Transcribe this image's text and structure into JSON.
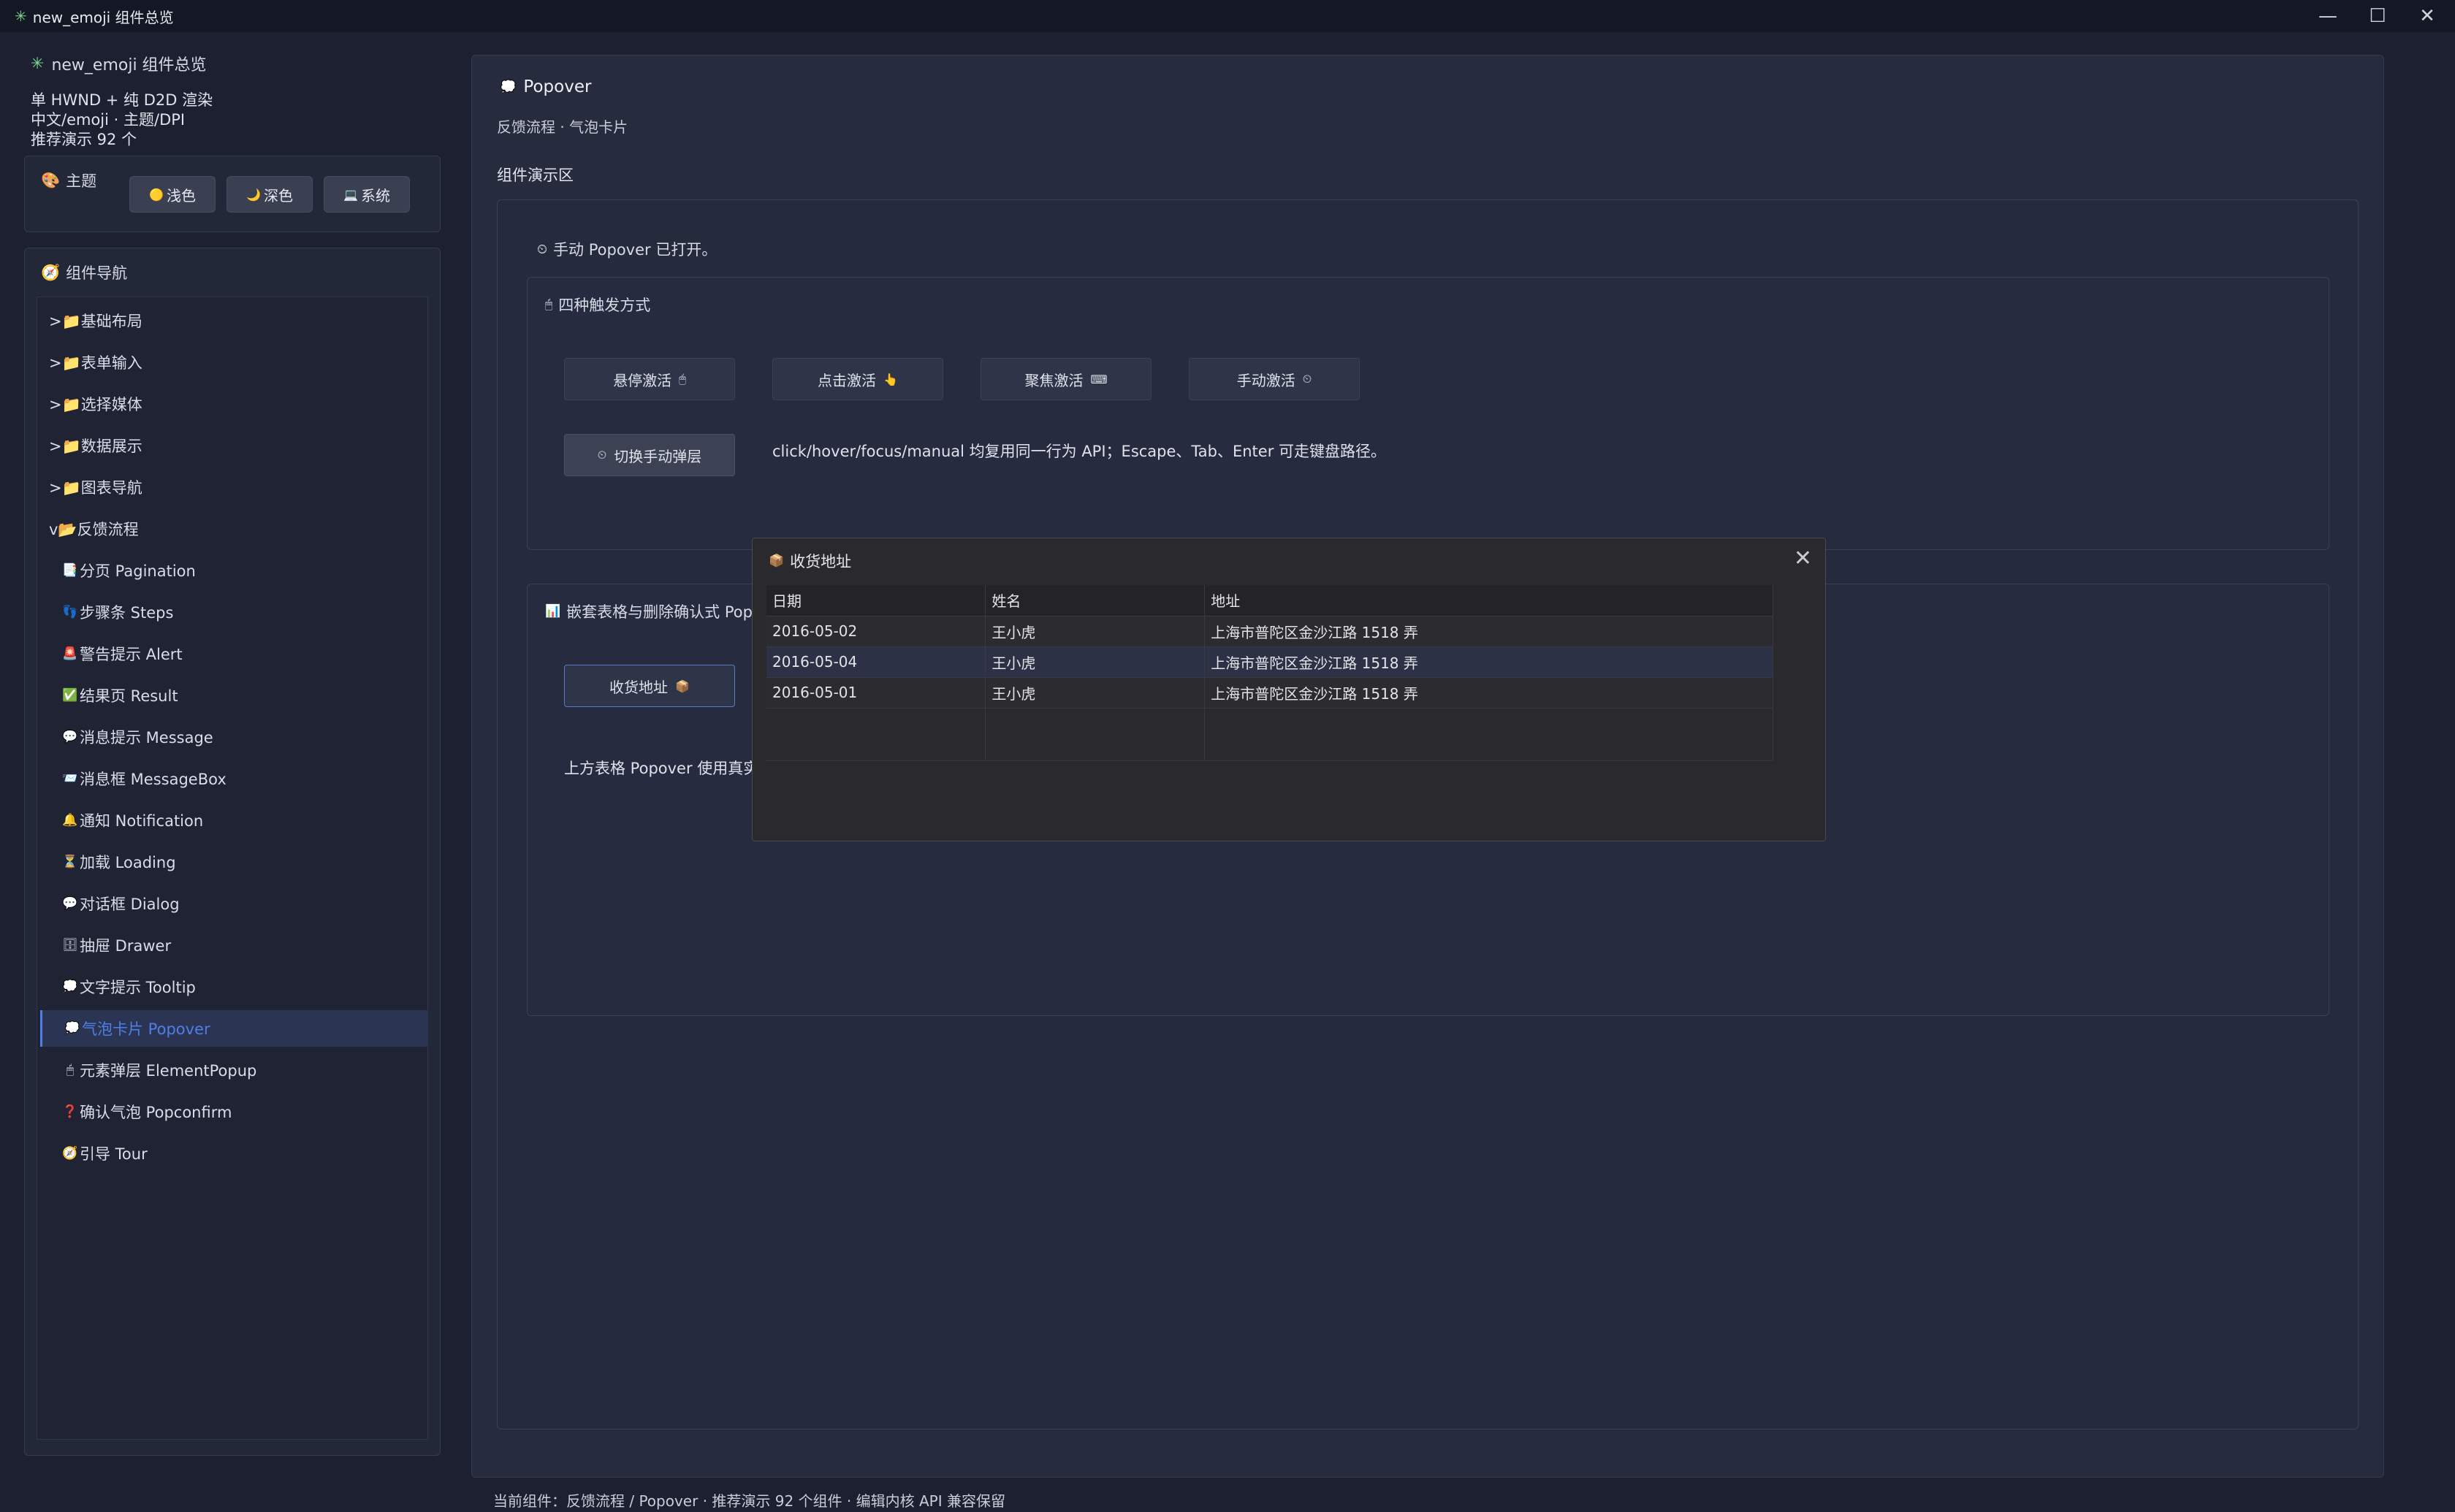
{
  "window": {
    "title": "new_emoji 组件总览",
    "app_icon": "✳",
    "controls": {
      "minimize": "—",
      "maximize": "☐",
      "close": "✕"
    }
  },
  "sidebar": {
    "app_title": "new_emoji 组件总览",
    "meta": [
      "单 HWND + 纯 D2D 渲染",
      "中文/emoji · 主题/DPI",
      "推荐演示 92 个"
    ],
    "theme": {
      "title": "主题",
      "buttons": [
        {
          "icon": "🟡",
          "label": "浅色"
        },
        {
          "icon": "🌙",
          "label": "深色"
        },
        {
          "icon": "💻",
          "label": "系统"
        }
      ]
    },
    "nav": {
      "title": "组件导航",
      "items": [
        {
          "label": ">📁基础布局"
        },
        {
          "label": ">📁表单输入"
        },
        {
          "label": ">📁选择媒体"
        },
        {
          "label": ">📁数据展示"
        },
        {
          "label": ">📁图表导航"
        },
        {
          "label": "v📂反馈流程"
        },
        {
          "label": "分页 Pagination",
          "icon": "📑"
        },
        {
          "label": "步骤条 Steps",
          "icon": "👣"
        },
        {
          "label": "警告提示 Alert",
          "icon": "🚨"
        },
        {
          "label": "结果页 Result",
          "icon": "✅"
        },
        {
          "label": "消息提示 Message",
          "icon": "💬"
        },
        {
          "label": "消息框 MessageBox",
          "icon": "📨"
        },
        {
          "label": "通知 Notification",
          "icon": "🔔"
        },
        {
          "label": "加载 Loading",
          "icon": "⏳"
        },
        {
          "label": "对话框 Dialog",
          "icon": "💬"
        },
        {
          "label": "抽屉 Drawer",
          "icon": "🗄"
        },
        {
          "label": "文字提示 Tooltip",
          "icon": "💭"
        },
        {
          "label": "气泡卡片 Popover",
          "icon": "💭"
        },
        {
          "label": "元素弹层 ElementPopup",
          "icon": "🖱"
        },
        {
          "label": "确认气泡 Popconfirm",
          "icon": "❓"
        },
        {
          "label": "引导 Tour",
          "icon": "🧭"
        }
      ],
      "selected_index": 17
    }
  },
  "main": {
    "title_icon": "💭",
    "title": "Popover",
    "subtitle": "反馈流程 · 气泡卡片",
    "demo_label": "组件演示区",
    "status": "手动 Popover 已打开。",
    "status_icon": "⏲",
    "trigger_section": {
      "icon": "🖱",
      "title": "四种触发方式",
      "buttons": [
        {
          "label": "悬停激活",
          "icon": "🖱"
        },
        {
          "label": "点击激活",
          "icon": "👆"
        },
        {
          "label": "聚焦激活",
          "icon": "⌨"
        },
        {
          "label": "手动激活",
          "icon": "⏲"
        }
      ],
      "toggle_icon": "⏲",
      "toggle_label": "切换手动弹层",
      "description": "click/hover/focus/manual 均复用同一行为 API；Escape、Tab、Enter 可走键盘路径。"
    },
    "table_section": {
      "icon": "📊",
      "title": "嵌套表格与删除确认式 Pop",
      "address_button": "收货地址",
      "address_icon": "📦",
      "description": "上方表格 Popover 使用真实"
    }
  },
  "popover": {
    "icon": "📦",
    "title": "收货地址",
    "close": "✕",
    "columns": [
      "日期",
      "姓名",
      "地址"
    ],
    "rows": [
      [
        "2016-05-02",
        "王小虎",
        "上海市普陀区金沙江路 1518 弄"
      ],
      [
        "2016-05-04",
        "王小虎",
        "上海市普陀区金沙江路 1518 弄"
      ],
      [
        "2016-05-01",
        "王小虎",
        "上海市普陀区金沙江路 1518 弄"
      ]
    ]
  },
  "footer": "当前组件：反馈流程 / Popover · 推荐演示 92 个组件 · 编辑内核 API 兼容保留",
  "colors": {
    "accent": "#4e7ee8",
    "background": "#1c2030",
    "panel": "#262b3e"
  }
}
